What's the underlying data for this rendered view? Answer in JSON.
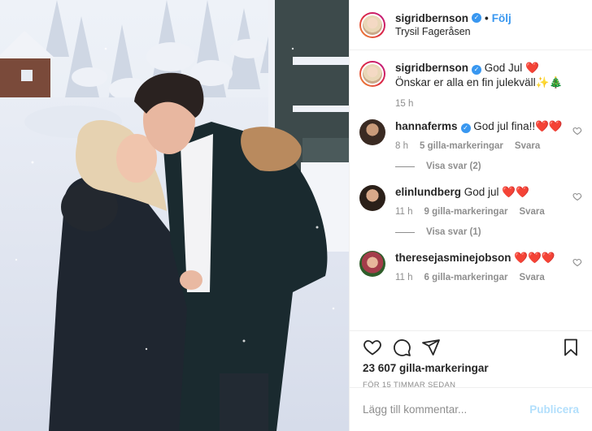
{
  "post": {
    "author": {
      "username": "sigridbernson",
      "verified_icon": "verified-badge-icon",
      "follow_separator": "•",
      "follow_label": "Följ",
      "location": "Trysil Fageråsen"
    },
    "photo": {
      "icon": "photo-couple-kissing-in-snow"
    },
    "caption": {
      "username": "sigridbernson",
      "text": " God Jul ❤️ Önskar er alla en fin julekväll✨🎄",
      "time": "15 h"
    },
    "comments": [
      {
        "username": "hannaferms",
        "verified": true,
        "text": " God jul fina!!❤️❤️",
        "time": "8 h",
        "likes": "5 gilla-markeringar",
        "reply_label": "Svara",
        "view_replies": "Visa svar (2)"
      },
      {
        "username": "elinlundberg",
        "verified": false,
        "text": " God jul ❤️❤️",
        "time": "11 h",
        "likes": "9 gilla-markeringar",
        "reply_label": "Svara",
        "view_replies": "Visa svar (1)"
      },
      {
        "username": "theresejasminejobson",
        "verified": false,
        "text": " ❤️❤️❤️",
        "time": "11 h",
        "likes": "6 gilla-markeringar",
        "reply_label": "Svara",
        "view_replies": ""
      }
    ],
    "actions": {
      "like_icon": "heart-icon",
      "comment_icon": "comment-icon",
      "share_icon": "share-icon",
      "save_icon": "bookmark-icon"
    },
    "likes_count": "23 607 gilla-markeringar",
    "posted_time": "FÖR 15 TIMMAR SEDAN",
    "add_comment": {
      "placeholder": "Lägg till kommentar...",
      "publish_label": "Publicera"
    }
  },
  "colors": {
    "accent": "#3897f0",
    "publish_disabled": "#b2dffc",
    "muted": "#8e8e8e",
    "text": "#262626"
  }
}
